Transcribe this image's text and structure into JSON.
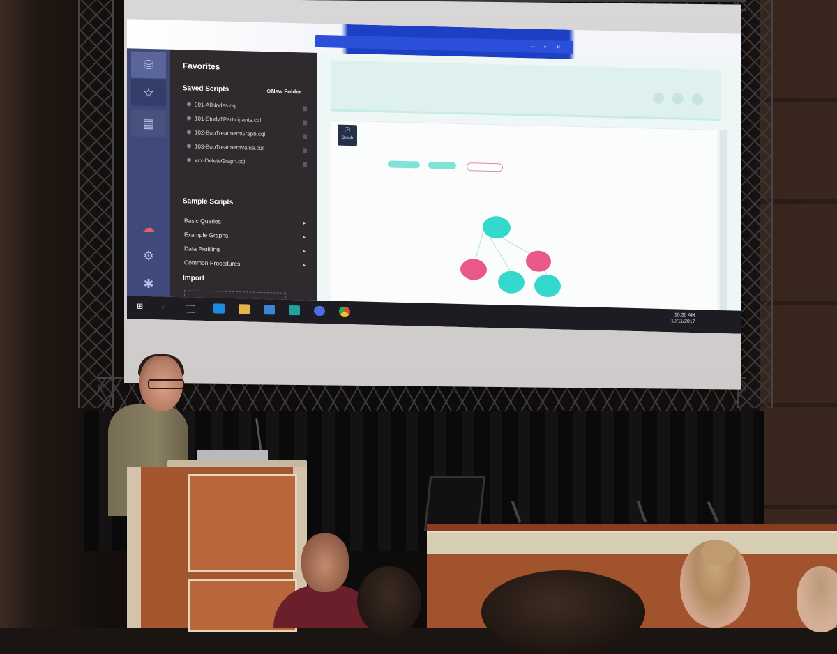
{
  "colors": {
    "rail": "#3f4a7a",
    "drawer": "#2e2a2e",
    "graph_teal": "#35d8cc",
    "graph_pink": "#e9588a",
    "taskbar": "#1c1c22",
    "podium_wood": "#b8663a"
  },
  "app": {
    "rail_icons": [
      "database-icon",
      "star-icon",
      "document-icon",
      "cloud-icon",
      "gear-icon",
      "bug-icon"
    ]
  },
  "favorites": {
    "title": "Favorites",
    "saved_scripts_heading": "Saved Scripts",
    "new_folder_label": "New Folder",
    "saved_scripts": [
      "001-AllNodes.cql",
      "101-Study1Participants.cql",
      "102-BobTreatmentGraph.cql",
      "103-BobTreatmentValue.cql",
      "xxx-DeleteGraph.cql"
    ],
    "sample_scripts_heading": "Sample Scripts",
    "sample_scripts": [
      "Basic Queries",
      "Example Graphs",
      "Data Profiling",
      "Common Procedures"
    ],
    "import_heading": "Import"
  },
  "graph": {
    "mode_label": "Graph",
    "nodes": [
      {
        "color": "teal"
      },
      {
        "color": "pink"
      },
      {
        "color": "pink"
      },
      {
        "color": "teal"
      },
      {
        "color": "teal"
      }
    ]
  },
  "taskbar": {
    "time": "10:30 AM",
    "date": "10/11/2017"
  }
}
